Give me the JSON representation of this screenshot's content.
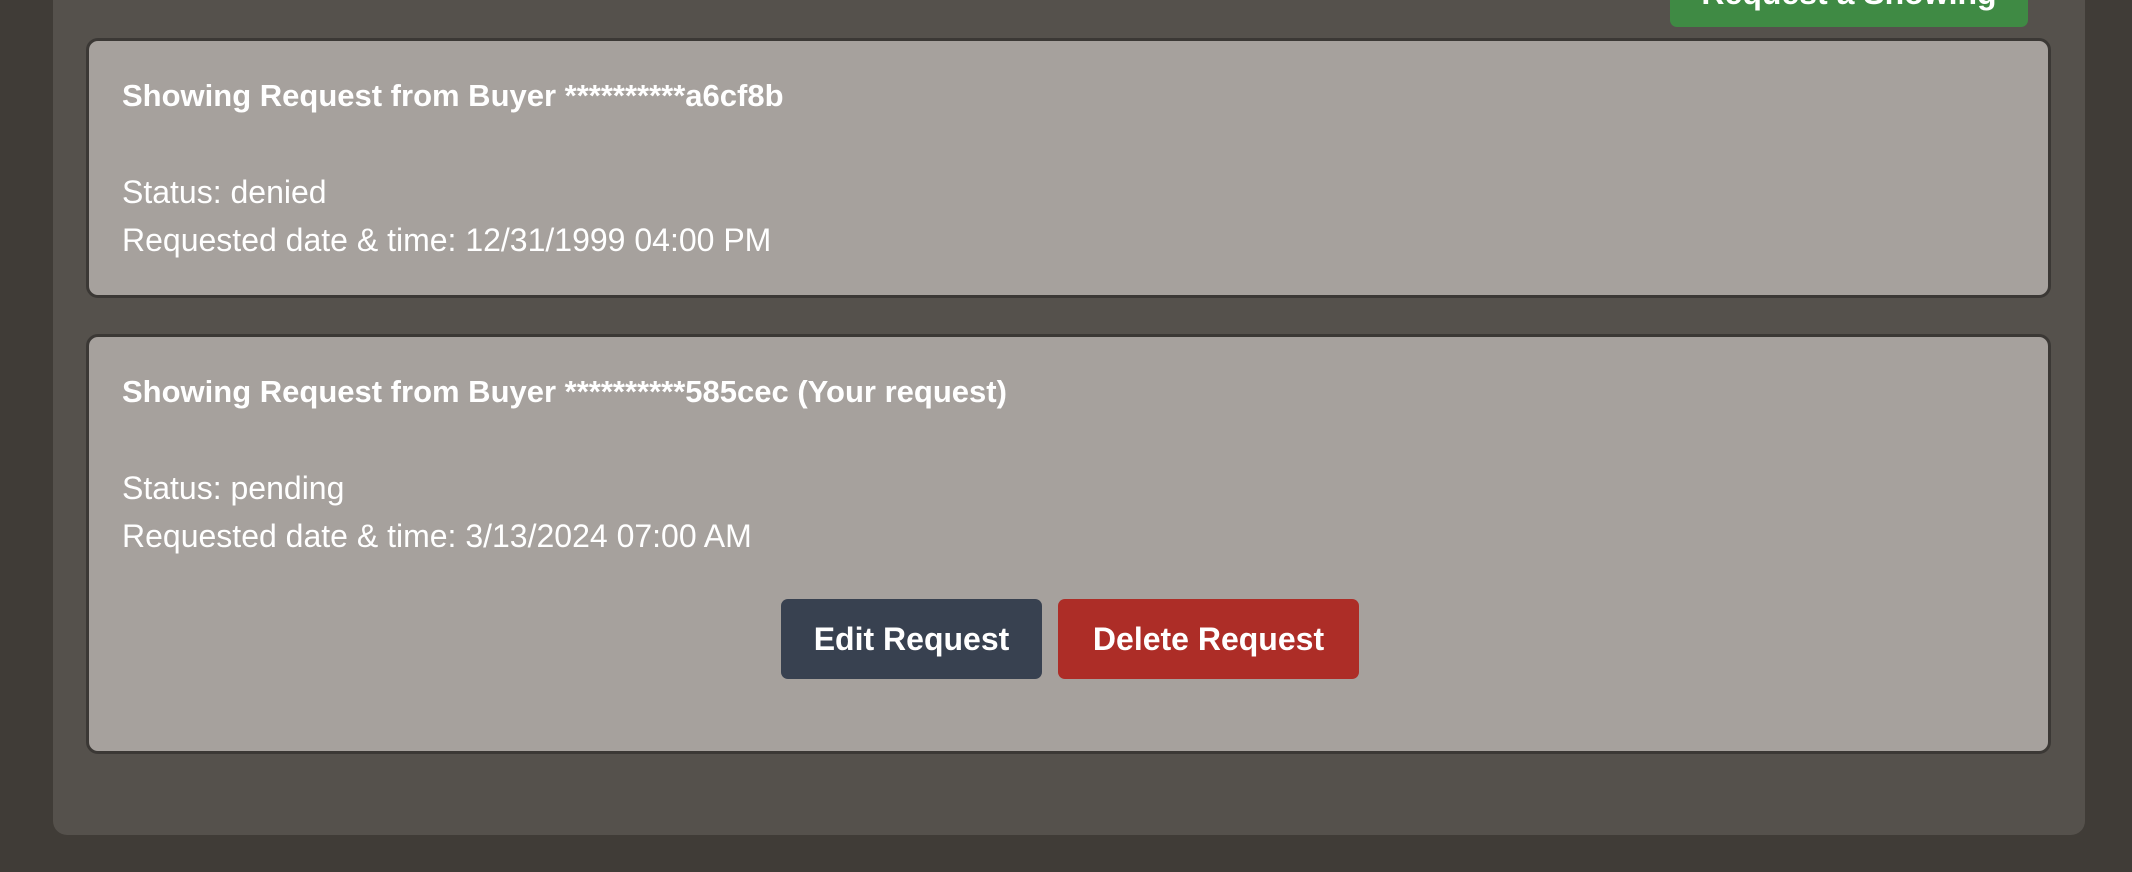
{
  "header": {
    "top_button_label": "Request a Showing"
  },
  "requests": [
    {
      "title": "Showing Request from Buyer **********a6cf8b",
      "status_line": "Status: denied",
      "requested_line": "Requested date & time: 12/31/1999 04:00 PM"
    },
    {
      "title": "Showing Request from Buyer **********585cec (Your request)",
      "status_line": "Status: pending",
      "requested_line": "Requested date & time: 3/13/2024 07:00 AM",
      "edit_label": "Edit Request",
      "delete_label": "Delete Request"
    }
  ],
  "colors": {
    "page_background": "#403c37",
    "panel_background": "#55514c",
    "card_background": "#a6a19d",
    "primary_green": "#3f8a44",
    "edit_button": "#384150",
    "delete_button": "#ad2d27"
  }
}
